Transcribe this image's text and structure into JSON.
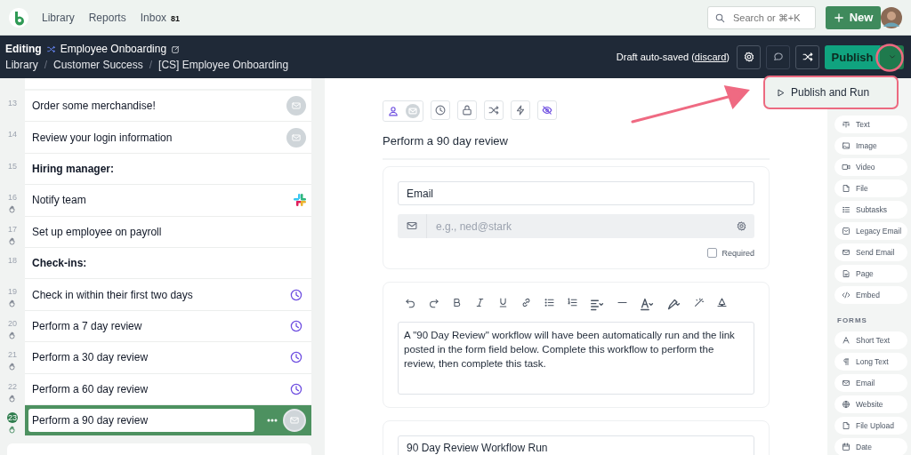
{
  "app_bar": {
    "nav": [
      {
        "label": "Library"
      },
      {
        "label": "Reports"
      },
      {
        "label": "Inbox",
        "badge": "81"
      }
    ],
    "search": {
      "placeholder": "Search or ⌘+K"
    },
    "new_button": "New"
  },
  "edit_bar": {
    "mode": "Editing",
    "workflow": "Employee Onboarding",
    "breadcrumbs": [
      {
        "kind": "link",
        "label": "Library"
      },
      {
        "kind": "separator",
        "label": "/"
      },
      {
        "kind": "link",
        "label": "Customer Success"
      },
      {
        "kind": "separator",
        "label": "/"
      },
      {
        "kind": "link",
        "label": "[CS] Employee Onboarding"
      }
    ],
    "draft_text": "Draft auto-saved (",
    "discard_link": "discard",
    "draft_close": ")",
    "publish_button": "Publish"
  },
  "publish_menu": {
    "items": [
      {
        "label": "Publish and Run"
      }
    ]
  },
  "tasks": [
    {
      "number": "13",
      "title": "Order some merchandise!",
      "kind": "send_email",
      "assigned": false,
      "selected": false
    },
    {
      "number": "14",
      "title": "Review your login information",
      "kind": "send_email",
      "assigned": false,
      "selected": false
    },
    {
      "number": "15",
      "title": "Hiring manager:",
      "kind": "heading",
      "assigned": false,
      "selected": false
    },
    {
      "number": "16",
      "title": "Notify team",
      "kind": "slack",
      "assigned": true,
      "selected": false
    },
    {
      "number": "17",
      "title": "Set up employee on payroll",
      "kind": "task",
      "assigned": true,
      "selected": false
    },
    {
      "number": "18",
      "title": "Check-ins:",
      "kind": "heading",
      "assigned": false,
      "selected": false
    },
    {
      "number": "19",
      "title": "Check in within their first two days",
      "kind": "scheduled",
      "assigned": true,
      "selected": false
    },
    {
      "number": "20",
      "title": "Perform a 7 day review",
      "kind": "scheduled",
      "assigned": true,
      "selected": false
    },
    {
      "number": "21",
      "title": "Perform a 30 day review",
      "kind": "scheduled",
      "assigned": true,
      "selected": false
    },
    {
      "number": "22",
      "title": "Perform a 60 day review",
      "kind": "scheduled",
      "assigned": true,
      "selected": false
    },
    {
      "number": "23",
      "title": "Perform a 90 day review",
      "kind": "send_email",
      "assigned": true,
      "selected": true
    }
  ],
  "editor": {
    "title": "Perform a 90 day review",
    "cards": [
      {
        "kind": "email_field",
        "label": "Email",
        "placeholder": "e.g., ned@stark",
        "required": false,
        "required_label": "Required"
      },
      {
        "kind": "rich_text",
        "content": "A \"90 Day Review\" workflow will have been automatically run and the link posted in the form field below. Complete this workflow to perform the review, then complete this task."
      },
      {
        "kind": "field",
        "label": "90 Day Review Workflow Run"
      }
    ]
  },
  "palette": {
    "content": [
      {
        "label": "Text",
        "kind": "text"
      },
      {
        "label": "Image",
        "kind": "image"
      },
      {
        "label": "Video",
        "kind": "video"
      },
      {
        "label": "File",
        "kind": "file"
      },
      {
        "label": "Subtasks",
        "kind": "subtasks"
      },
      {
        "label": "Legacy Email",
        "kind": "legacy_email"
      },
      {
        "label": "Send Email",
        "kind": "send_email"
      },
      {
        "label": "Page",
        "kind": "page"
      },
      {
        "label": "Embed",
        "kind": "embed"
      }
    ],
    "forms_heading": "FORMS",
    "forms": [
      {
        "label": "Short Text",
        "kind": "short_text"
      },
      {
        "label": "Long Text",
        "kind": "long_text"
      },
      {
        "label": "Email",
        "kind": "email"
      },
      {
        "label": "Website",
        "kind": "website"
      },
      {
        "label": "File Upload",
        "kind": "file_upload"
      },
      {
        "label": "Date",
        "kind": "date"
      }
    ]
  }
}
